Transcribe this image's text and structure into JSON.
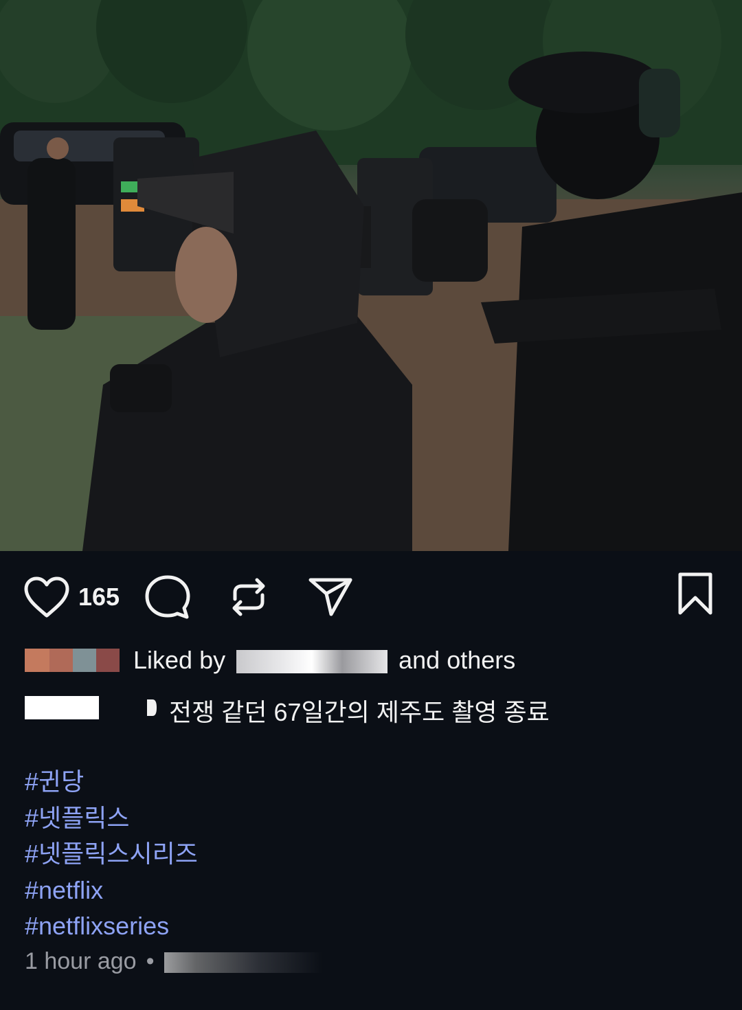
{
  "post": {
    "image_alt": "Film crew members with camera and headsets on set",
    "likes_count": "165",
    "liked_by_prefix": "Liked by",
    "liked_by_suffix": "and others",
    "caption": "전쟁 같던 67일간의 제주도 촬영 종료",
    "hashtags": [
      "#귄당",
      "#넷플릭스",
      "#넷플릭스시리즈",
      "#netflix",
      "#netflixseries"
    ],
    "time_ago": "1 hour ago",
    "separator": "•"
  },
  "icons": {
    "like": "heart-icon",
    "comment": "comment-icon",
    "repost": "repost-icon",
    "share": "send-icon",
    "save": "bookmark-icon"
  },
  "colors": {
    "background": "#0b0f16",
    "text": "#f2f2f2",
    "hashtag": "#8ea3f5",
    "muted": "#9a9ca3"
  }
}
